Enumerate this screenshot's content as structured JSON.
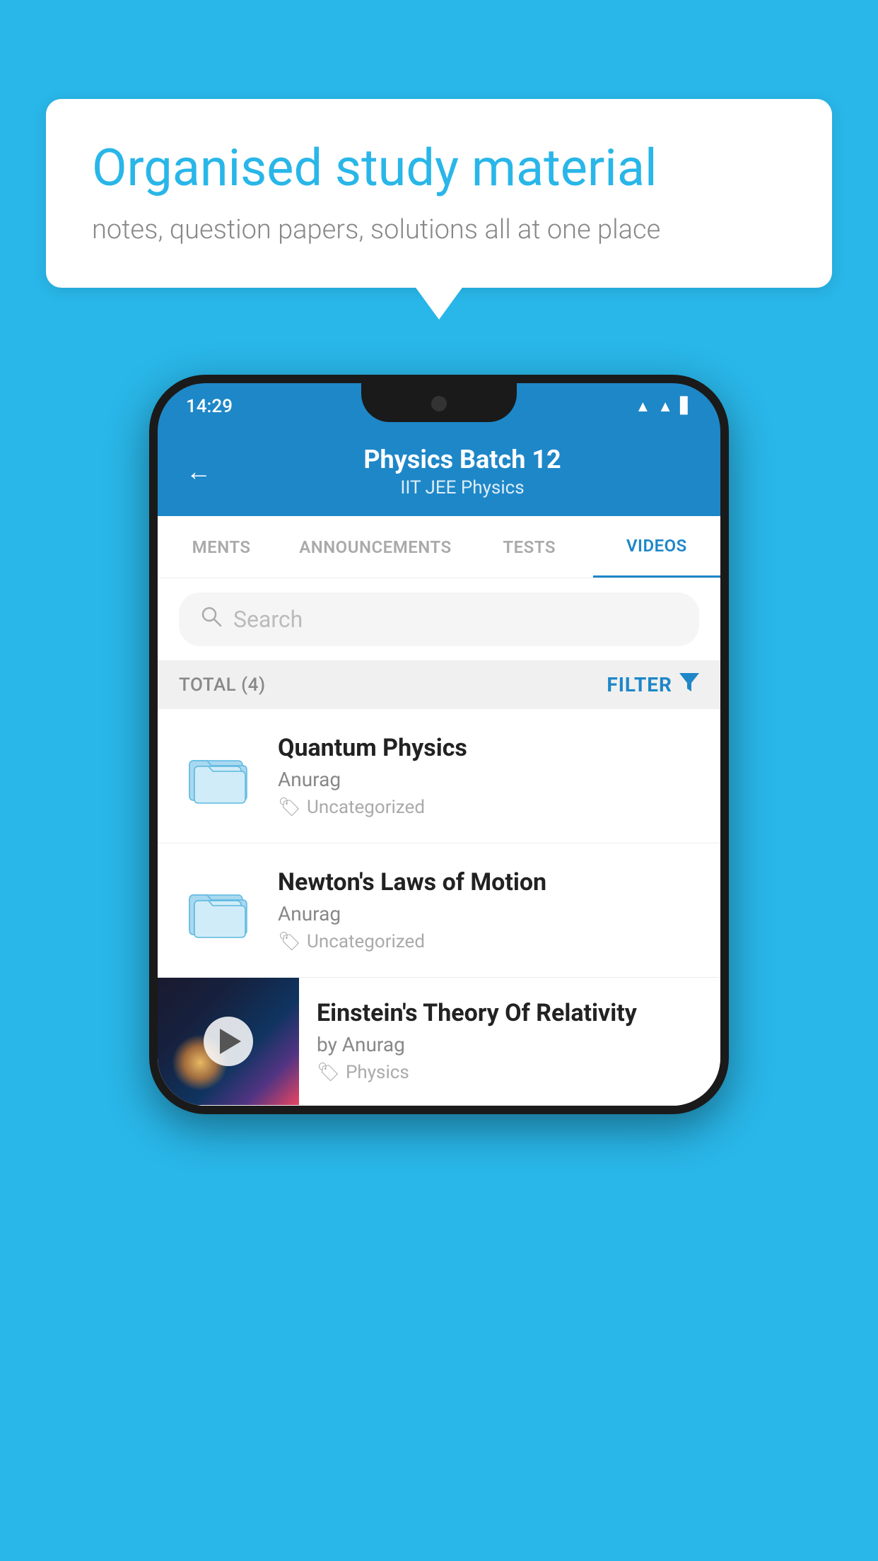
{
  "background_color": "#29b6e8",
  "speech_bubble": {
    "headline": "Organised study material",
    "subtext": "notes, question papers, solutions all at one place"
  },
  "phone": {
    "status_bar": {
      "time": "14:29"
    },
    "app_header": {
      "back_label": "←",
      "title": "Physics Batch 12",
      "subtitle": "IIT JEE   Physics"
    },
    "tabs": [
      {
        "label": "MENTS",
        "active": false
      },
      {
        "label": "ANNOUNCEMENTS",
        "active": false
      },
      {
        "label": "TESTS",
        "active": false
      },
      {
        "label": "VIDEOS",
        "active": true
      }
    ],
    "search": {
      "placeholder": "Search"
    },
    "filter_bar": {
      "total_label": "TOTAL (4)",
      "filter_label": "FILTER"
    },
    "videos": [
      {
        "id": 1,
        "title": "Quantum Physics",
        "author": "Anurag",
        "tag": "Uncategorized",
        "type": "folder"
      },
      {
        "id": 2,
        "title": "Newton's Laws of Motion",
        "author": "Anurag",
        "tag": "Uncategorized",
        "type": "folder"
      },
      {
        "id": 3,
        "title": "Einstein's Theory Of Relativity",
        "author": "by Anurag",
        "tag": "Physics",
        "type": "video"
      }
    ]
  }
}
